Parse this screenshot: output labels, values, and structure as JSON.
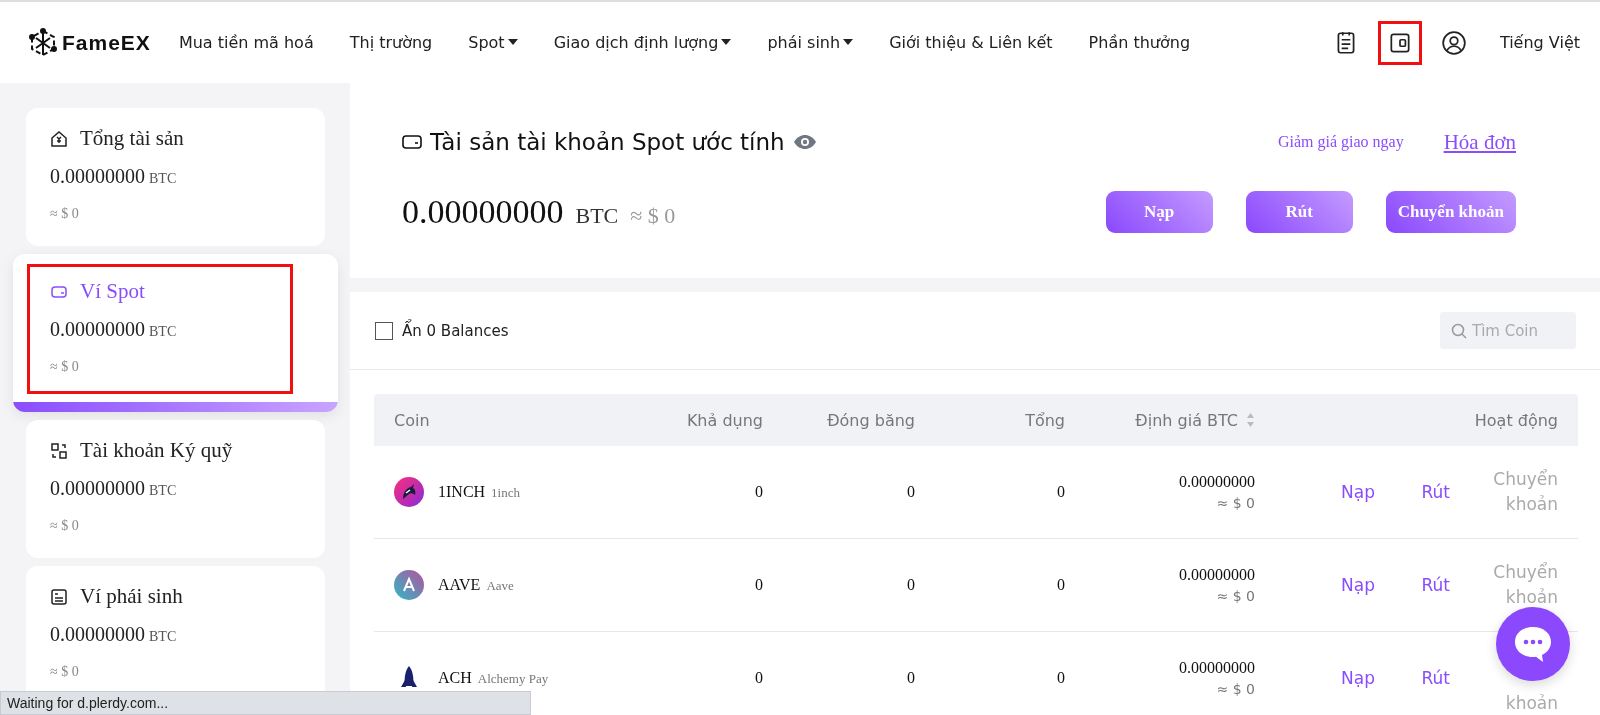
{
  "header": {
    "brand": "FameEX",
    "menu": [
      {
        "label": "Mua tiền mã hoá",
        "caret": false
      },
      {
        "label": "Thị trường",
        "caret": false
      },
      {
        "label": "Spot",
        "caret": true
      },
      {
        "label": "Giao dịch định lượng",
        "caret": true
      },
      {
        "label": "phái sinh",
        "caret": true
      },
      {
        "label": "Giới thiệu & Liên kết",
        "caret": false
      },
      {
        "label": "Phần thưởng",
        "caret": false
      }
    ],
    "icons": [
      {
        "kind": "orders",
        "annotated": false
      },
      {
        "kind": "wallet",
        "annotated": true
      },
      {
        "kind": "user",
        "annotated": false
      }
    ],
    "language": "Tiếng Việt"
  },
  "sidebar": {
    "cards": [
      {
        "kind": "total",
        "title": "Tổng tài sản",
        "amount": "0.00000000",
        "unit": "BTC",
        "fiat": "≈ $ 0",
        "selected": false,
        "annotated": false
      },
      {
        "kind": "spot",
        "title": "Ví Spot",
        "amount": "0.00000000",
        "unit": "BTC",
        "fiat": "≈ $ 0",
        "selected": true,
        "annotated": true
      },
      {
        "kind": "margin",
        "title": "Tài khoản Ký quỹ",
        "amount": "0.00000000",
        "unit": "BTC",
        "fiat": "≈ $ 0",
        "selected": false,
        "annotated": false
      },
      {
        "kind": "futures",
        "title": "Ví phái sinh",
        "amount": "0.00000000",
        "unit": "BTC",
        "fiat": "≈ $ 0",
        "selected": false,
        "annotated": false
      }
    ]
  },
  "summary": {
    "title": "Tài sản tài khoản Spot ước tính",
    "amount": "0.00000000",
    "unit": "BTC",
    "fiat": "≈ $ 0",
    "links": [
      {
        "label": "Giảm giá giao ngay",
        "underlined": false
      },
      {
        "label": "Hóa đơn",
        "underlined": true
      }
    ],
    "buttons": [
      "Nạp",
      "Rút",
      "Chuyển khoản"
    ]
  },
  "filter": {
    "label": "Ẩn 0 Balances",
    "checked": false,
    "search_placeholder": "Tìm Coin"
  },
  "table": {
    "columns": [
      "Coin",
      "Khả dụng",
      "Đóng băng",
      "Tổng",
      "Định giá BTC",
      "Hoạt động"
    ],
    "rows": [
      {
        "symbol": "1INCH",
        "name": "1inch",
        "available": "0",
        "frozen": "0",
        "total": "0",
        "btc_value": "0.00000000",
        "fiat_value": "≈ $ 0",
        "deposit": "Nạp",
        "withdraw": "Rút",
        "transfer": "Chuyển khoản"
      },
      {
        "symbol": "AAVE",
        "name": "Aave",
        "available": "0",
        "frozen": "0",
        "total": "0",
        "btc_value": "0.00000000",
        "fiat_value": "≈ $ 0",
        "deposit": "Nạp",
        "withdraw": "Rút",
        "transfer": "Chuyển khoản"
      },
      {
        "symbol": "ACH",
        "name": "Alchemy Pay",
        "available": "0",
        "frozen": "0",
        "total": "0",
        "btc_value": "0.00000000",
        "fiat_value": "≈ $ 0",
        "deposit": "Nạp",
        "withdraw": "Rút",
        "transfer": "khoản"
      }
    ]
  },
  "status_bar": "Waiting for d.plerdy.com..."
}
